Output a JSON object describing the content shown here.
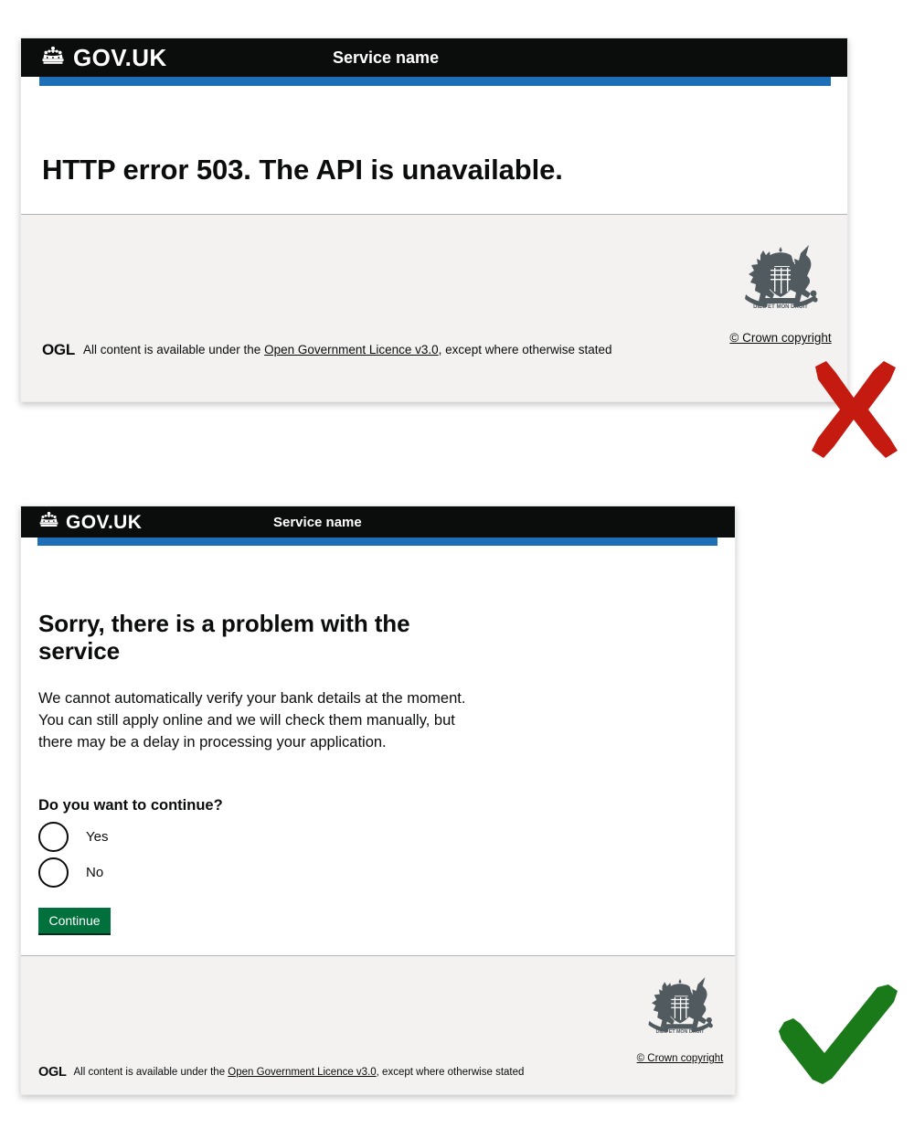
{
  "page": {
    "background": "#ffffff",
    "brand_black": "#0b0c0c",
    "brand_blue": "#1d70b8",
    "brand_green": "#00703c",
    "footer_grey": "#f3f2f1",
    "cross_red": "#c41a10",
    "tick_green": "#1a7a1a"
  },
  "examples": [
    {
      "id": "bad-example",
      "mark": "cross-mark",
      "mark_meaning": "incorrect example",
      "header": {
        "logo_icon": "crown-icon",
        "wordmark": "GOV.UK",
        "service_name": "Service name"
      },
      "content": {
        "heading": "HTTP error 503. The API is unavailable."
      },
      "footer": {
        "ogl_badge": "OGL",
        "licence_prefix": "All content is available under the ",
        "licence_link": "Open Government Licence v3.0",
        "licence_suffix": ", except where otherwise stated",
        "crest_icon": "royal-coat-of-arms-icon",
        "crown_copyright": "© Crown copyright"
      }
    },
    {
      "id": "good-example",
      "mark": "tick-mark",
      "mark_meaning": "correct example",
      "header": {
        "logo_icon": "crown-icon",
        "wordmark": "GOV.UK",
        "service_name": "Service name"
      },
      "content": {
        "heading": "Sorry, there is a problem with the service",
        "body": "We cannot automatically verify your bank details at the moment. You can still apply online and we will check them manually, but there may be a delay in processing your application.",
        "question_legend": "Do you want to continue?",
        "radios": [
          {
            "value": "yes",
            "label": "Yes",
            "checked": false
          },
          {
            "value": "no",
            "label": "No",
            "checked": false
          }
        ],
        "submit_label": "Continue"
      },
      "footer": {
        "ogl_badge": "OGL",
        "licence_prefix": "All content is available under the ",
        "licence_link": "Open Government Licence v3.0",
        "licence_suffix": ", except where otherwise stated",
        "crest_icon": "royal-coat-of-arms-icon",
        "crown_copyright": "© Crown copyright"
      }
    }
  ]
}
